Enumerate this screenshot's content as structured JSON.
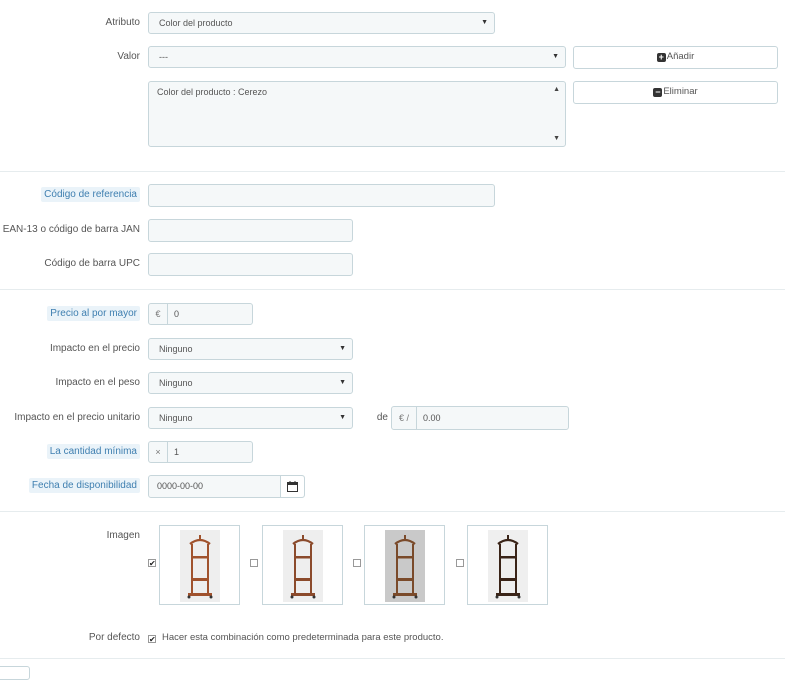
{
  "attribute": {
    "label": "Atributo",
    "value": "Color del producto"
  },
  "value_row": {
    "label": "Valor",
    "value": "---",
    "add_button": "Añadir",
    "remove_button": "Eliminar",
    "combination_item": "Color del producto : Cerezo"
  },
  "reference": {
    "label": "Código de referencia",
    "value": ""
  },
  "ean13": {
    "label": "EAN-13 o código de barra JAN",
    "value": ""
  },
  "upc": {
    "label": "Código de barra UPC",
    "value": ""
  },
  "wholesale": {
    "label": "Precio al por mayor",
    "prefix": "€",
    "value": "0"
  },
  "price_impact": {
    "label": "Impacto en el precio",
    "value": "Ninguno"
  },
  "weight_impact": {
    "label": "Impacto en el peso",
    "value": "Ninguno"
  },
  "unit_price_impact": {
    "label": "Impacto en el precio unitario",
    "value": "Ninguno",
    "de_label": "de",
    "prefix": "€ /",
    "amount": "0.00"
  },
  "min_qty": {
    "label": "La cantidad mínima",
    "prefix": "×",
    "value": "1"
  },
  "availability": {
    "label": "Fecha de disponibilidad",
    "value": "0000-00-00"
  },
  "images": {
    "label": "Imagen",
    "items": [
      {
        "checked": true,
        "tone": "#a0522d",
        "bg": "#eeeeee"
      },
      {
        "checked": false,
        "tone": "#8b4a2b",
        "bg": "#eeeeee"
      },
      {
        "checked": false,
        "tone": "#7a4a2a",
        "bg": "#c9c9c9"
      },
      {
        "checked": false,
        "tone": "#3a2418",
        "bg": "#efefef"
      }
    ]
  },
  "default": {
    "label": "Por defecto",
    "checked": true,
    "text": "Hacer esta combinación como predeterminada para este producto."
  }
}
